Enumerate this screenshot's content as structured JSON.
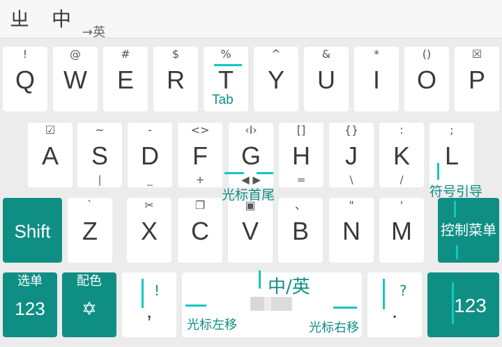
{
  "candidates": {
    "c1": "ㄓ",
    "c2": "中",
    "hint": "→英"
  },
  "row1": [
    {
      "top": "!",
      "main": "Q"
    },
    {
      "top": "@",
      "main": "W"
    },
    {
      "top": "#",
      "main": "E"
    },
    {
      "top": "$",
      "main": "R"
    },
    {
      "top": "%",
      "main": "T",
      "sub": "Tab"
    },
    {
      "top": "^",
      "main": "Y"
    },
    {
      "top": "&",
      "main": "U"
    },
    {
      "top": "*",
      "main": "I"
    },
    {
      "top": "()",
      "main": "O"
    },
    {
      "top": "☒",
      "main": "P"
    }
  ],
  "row2": [
    {
      "top": "☑",
      "main": "A",
      "bot": ""
    },
    {
      "top": "~",
      "main": "S",
      "bot": "|"
    },
    {
      "top": "-",
      "main": "D",
      "bot": "_"
    },
    {
      "top": "<>",
      "main": "F",
      "bot": "+"
    },
    {
      "top": "‹I›",
      "main": "G",
      "bot": "◀ ▶"
    },
    {
      "top": "[]",
      "main": "H",
      "bot": "="
    },
    {
      "top": "{}",
      "main": "J",
      "bot": "\\"
    },
    {
      "top": ":",
      "main": "K",
      "bot": "/"
    },
    {
      "top": ";",
      "main": "L",
      "bot": ""
    }
  ],
  "row3": [
    {
      "top": "`",
      "main": "Z"
    },
    {
      "top": "✂",
      "main": "X"
    },
    {
      "top": "❐",
      "main": "C"
    },
    {
      "top": "▣",
      "main": "V"
    },
    {
      "top": "、",
      "main": "B"
    },
    {
      "top": "\"",
      "main": "N"
    },
    {
      "top": "'",
      "main": "M"
    }
  ],
  "shift_label": "Shift",
  "control_menu_label": "控制菜单",
  "bottom": {
    "menu_top": "选单",
    "menu_main": "123",
    "color_top": "配色",
    "color_icon": "✡",
    "comma_main": ",",
    "comma_hint": "!",
    "period_main": ".",
    "period_hint": "?",
    "numbers_main": "123"
  },
  "annotations": {
    "tab": "Tab",
    "cursor_ends": "光标首尾",
    "symbol_guide": "符号引导",
    "lang_switch": "中/英",
    "cursor_left": "光标左移",
    "cursor_right": "光标右移"
  },
  "colors": {
    "accent": "#0f8f84",
    "arrow": "#13c6c0"
  }
}
